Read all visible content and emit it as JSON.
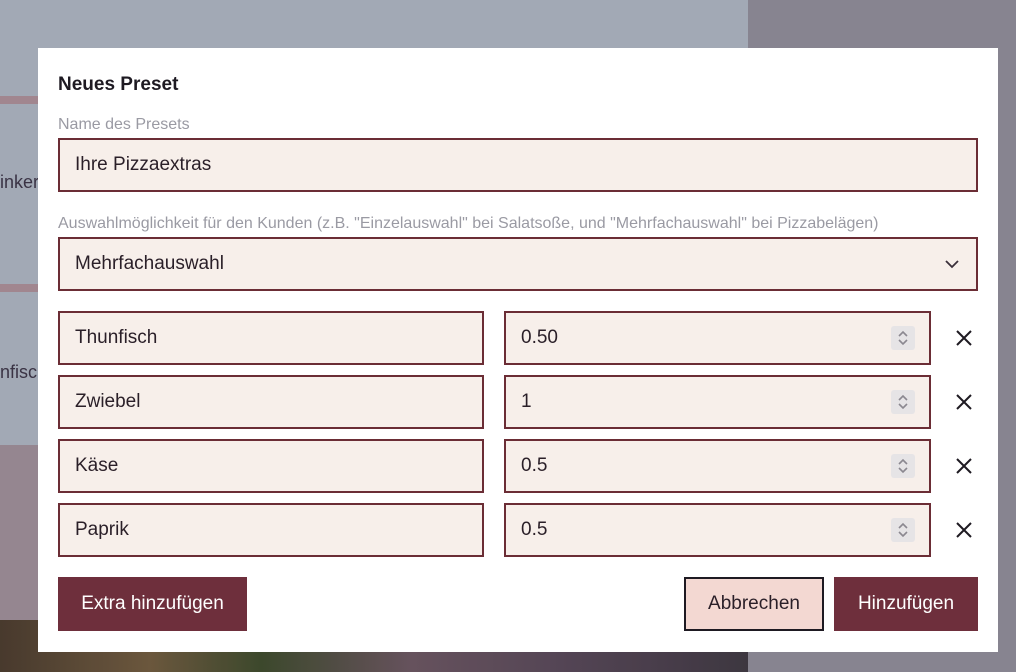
{
  "background": {
    "partial_text_1": "inker",
    "partial_text_2": "nfisc"
  },
  "dialog": {
    "title": "Neues Preset",
    "name_label": "Name des Presets",
    "name_value": "Ihre Pizzaextras",
    "choice_label": "Auswahlmöglichkeit für den Kunden (z.B. \"Einzelauswahl\" bei Salatsoße, und \"Mehrfachauswahl\" bei Pizzabelägen)",
    "choice_value": "Mehrfachauswahl",
    "extras": [
      {
        "name": "Thunfisch",
        "price": "0.50"
      },
      {
        "name": "Zwiebel",
        "price": "1"
      },
      {
        "name": "Käse",
        "price": "0.5"
      },
      {
        "name": "Paprik",
        "price": "0.5"
      }
    ],
    "add_extra_label": "Extra hinzufügen",
    "cancel_label": "Abbrechen",
    "submit_label": "Hinzufügen"
  },
  "icons": {
    "chevron": "chevron-down-icon",
    "remove": "close-icon",
    "spinner": "spinner-arrows-icon"
  },
  "colors": {
    "accent": "#6e2f3c",
    "input_bg": "#f7efea",
    "input_border": "#6b2d35",
    "cancel_bg": "#f3d8d2"
  }
}
